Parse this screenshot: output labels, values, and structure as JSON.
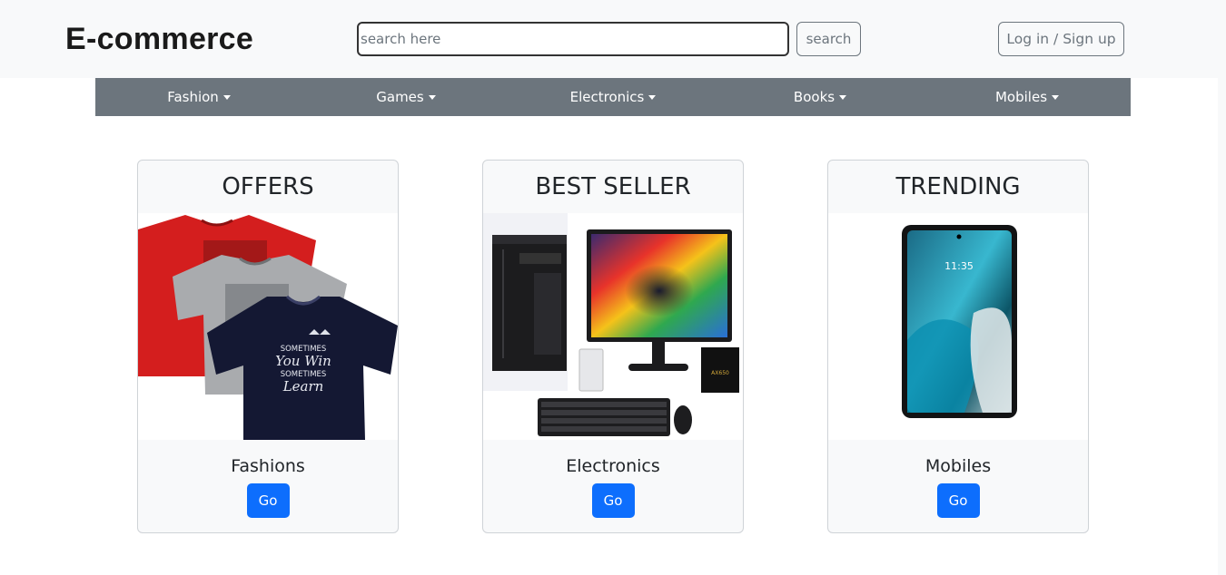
{
  "brand": "E-commerce",
  "search": {
    "placeholder": "search here",
    "button_label": "search"
  },
  "auth": {
    "label": "Log in / Sign up"
  },
  "categories": [
    {
      "label": "Fashion"
    },
    {
      "label": "Games"
    },
    {
      "label": "Electronics"
    },
    {
      "label": "Books"
    },
    {
      "label": "Mobiles"
    }
  ],
  "cards": [
    {
      "title": "OFFERS",
      "image": "tshirts-image",
      "label": "Fashions",
      "button": "Go"
    },
    {
      "title": "BEST SELLER",
      "image": "computer-setup-image",
      "label": "Electronics",
      "button": "Go"
    },
    {
      "title": "TRENDING",
      "image": "smartphone-image",
      "label": "Mobiles",
      "button": "Go"
    }
  ],
  "tshirt_print": {
    "line1": "SOMETIMES",
    "line2": "You Win",
    "line3": "SOMETIMES",
    "line4": "Learn"
  },
  "phone_clock": "11:35",
  "colors": {
    "primary": "#0d6efd",
    "nav": "#6c757d",
    "header_bg": "#f8f9fa"
  }
}
